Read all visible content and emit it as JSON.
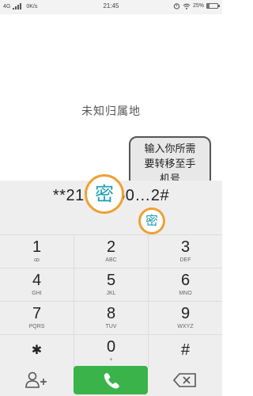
{
  "status_bar": {
    "network": "4G",
    "speed": "0K/s",
    "time": "21:45",
    "battery_percent": "25%",
    "battery_level": 0.25
  },
  "location_label": "未知归属地",
  "tooltip": {
    "lines": [
      "输入你所需",
      "要转移至手",
      "机号"
    ]
  },
  "dialed_number": "**21*1…60…2#",
  "stamp_text": "密",
  "keypad": [
    [
      {
        "digit": "1",
        "letters": "ꝏ"
      },
      {
        "digit": "2",
        "letters": "ABC"
      },
      {
        "digit": "3",
        "letters": "DEF"
      }
    ],
    [
      {
        "digit": "4",
        "letters": "GHI"
      },
      {
        "digit": "5",
        "letters": "JKL"
      },
      {
        "digit": "6",
        "letters": "MNO"
      }
    ],
    [
      {
        "digit": "7",
        "letters": "PQRS"
      },
      {
        "digit": "8",
        "letters": "TUV"
      },
      {
        "digit": "9",
        "letters": "WXYZ"
      }
    ],
    [
      {
        "digit": "✱",
        "letters": ""
      },
      {
        "digit": "0",
        "letters": "+"
      },
      {
        "digit": "#",
        "letters": ""
      }
    ]
  ],
  "bottom_bar": {
    "add_contact_icon": "person-add-icon",
    "call_icon": "phone-icon",
    "delete_icon": "backspace-icon"
  },
  "colors": {
    "call_button": "#39b34a",
    "stamp_border": "#f0a033",
    "stamp_text": "#1a9fb8"
  }
}
